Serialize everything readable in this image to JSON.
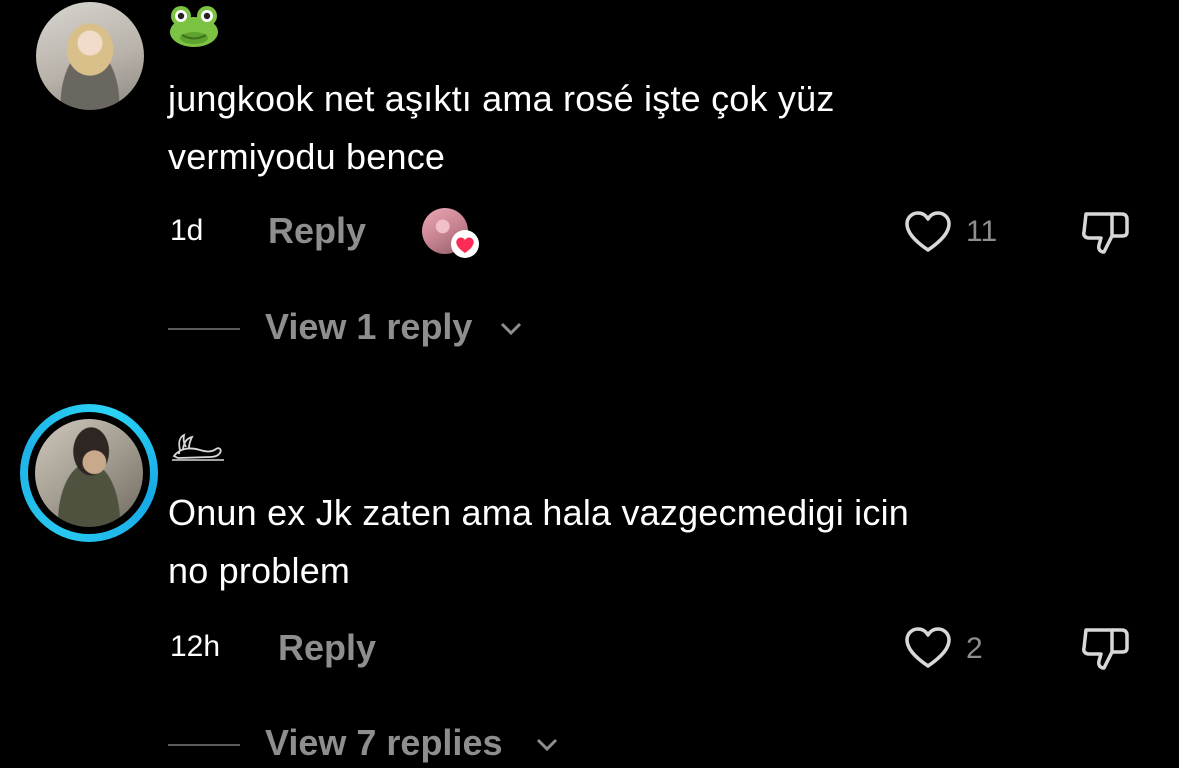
{
  "comments": [
    {
      "username_icon": "frog-emoji",
      "text_line1": "jungkook net aşıktı ama rosé işte çok yüz",
      "text_line2": "vermiyodu bence",
      "time": "1d",
      "reply_label": "Reply",
      "creator_liked": true,
      "like_count": "11",
      "view_replies_label": "View 1 reply"
    },
    {
      "username_icon": "hare-glyph",
      "text_line1": "Onun ex Jk zaten ama hala vazgecmedigi icin",
      "text_line2": "no problem",
      "time": "12h",
      "reply_label": "Reply",
      "creator_liked": false,
      "like_count": "2",
      "view_replies_label": "View 7 replies"
    }
  ],
  "colors": {
    "background": "#000000",
    "text_primary": "#ffffff",
    "text_secondary": "#8e8e8e",
    "story_ring": "#27c8f0",
    "creator_heart": "#fe2c55"
  }
}
